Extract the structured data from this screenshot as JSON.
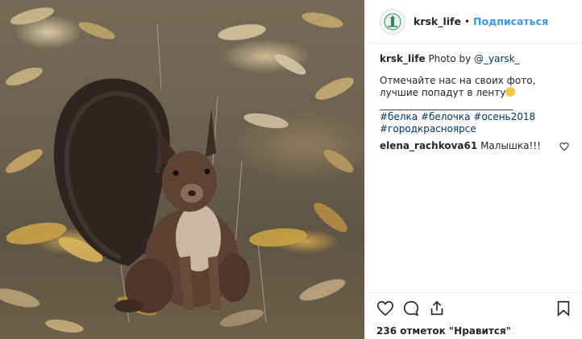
{
  "post": {
    "username": "krsk_life",
    "separator": "•",
    "follow_label": "Подписаться",
    "avatar_icon": "krasnoyarsk-chapel-logo",
    "photo_alt": "squirrel photo",
    "caption": {
      "author": "krsk_life",
      "photo_by_text": "Photo by",
      "photo_by_user": "@_yarsk_",
      "body": "Отмечайте нас на своих фото, лучшие попадут в ленту",
      "emoji": "smiling-face",
      "divider": "______________________________",
      "hashtags": [
        "#белка",
        "#белочка",
        "#осень2018",
        "#городкрасноярсе"
      ]
    },
    "comments": [
      {
        "author": "elena_rachkova61",
        "text": "Малышка!!!"
      }
    ],
    "likes_text": "236 отметок \"Нравится\"",
    "colors": {
      "accent": "#3897f0",
      "link": "#003569",
      "border": "#efefef"
    }
  }
}
